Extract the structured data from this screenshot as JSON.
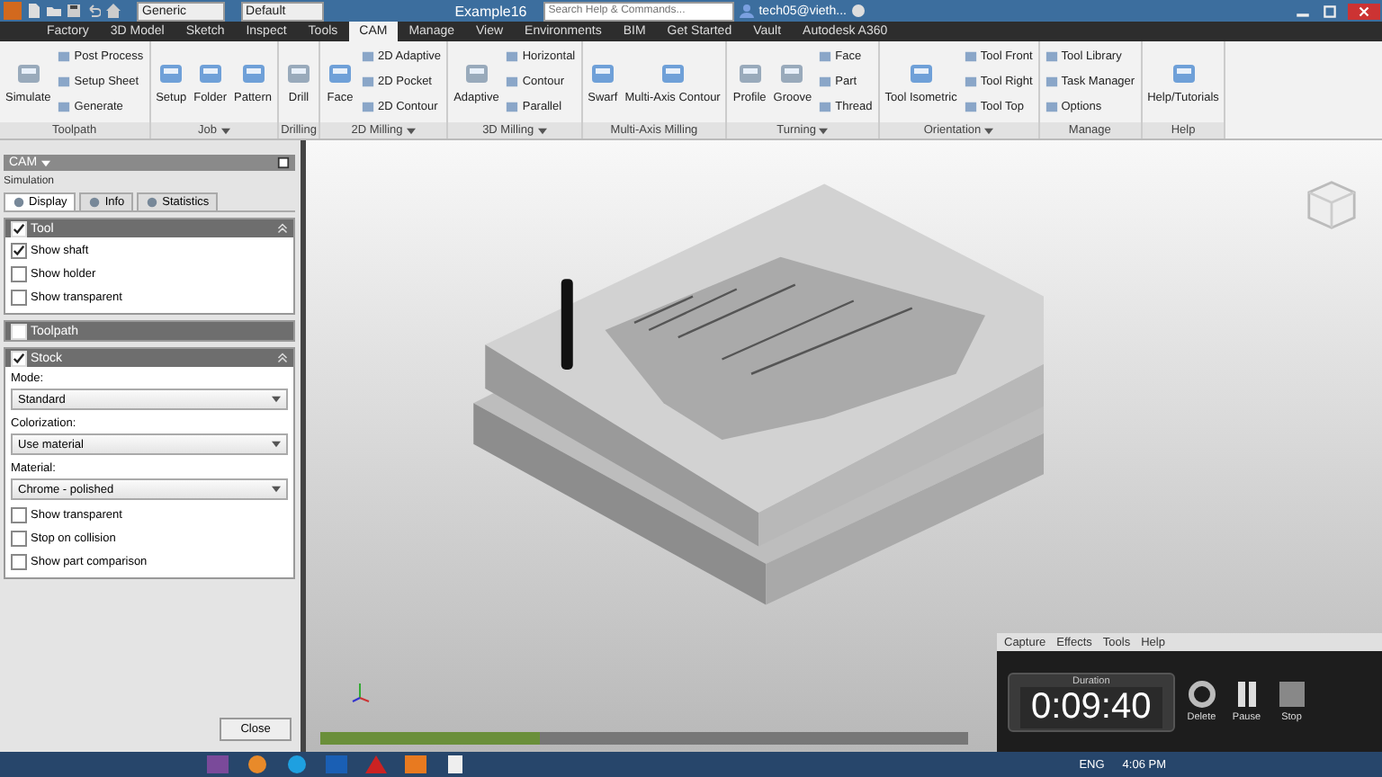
{
  "title_bar": {
    "style_dropdowns": [
      "Generic",
      "Default"
    ],
    "title": "Example16",
    "search": {
      "placeholder": "Search Help & Commands..."
    },
    "user": "tech05@vieth..."
  },
  "tabs": [
    {
      "label": "Factory",
      "selected": false
    },
    {
      "label": "3D Model",
      "selected": false
    },
    {
      "label": "Sketch",
      "selected": false
    },
    {
      "label": "Inspect",
      "selected": false
    },
    {
      "label": "Tools",
      "selected": false
    },
    {
      "label": "CAM",
      "selected": true
    },
    {
      "label": "Manage",
      "selected": false
    },
    {
      "label": "View",
      "selected": false
    },
    {
      "label": "Environments",
      "selected": false
    },
    {
      "label": "BIM",
      "selected": false
    },
    {
      "label": "Get Started",
      "selected": false
    },
    {
      "label": "Vault",
      "selected": false
    },
    {
      "label": "Autodesk A360",
      "selected": false
    }
  ],
  "ribbon": [
    {
      "label": "Toolpath",
      "menu": false,
      "large": [
        "Simulate"
      ],
      "small": [
        "Post Process",
        "Setup Sheet",
        "Generate"
      ]
    },
    {
      "label": "Job",
      "menu": true,
      "large": [
        "Setup",
        "Folder",
        "Pattern"
      ]
    },
    {
      "label": "Drilling",
      "menu": false,
      "large": [
        "Drill"
      ]
    },
    {
      "label": "2D Milling",
      "menu": true,
      "large": [
        "Face"
      ],
      "small": [
        "2D Adaptive",
        "2D Pocket",
        "2D Contour"
      ]
    },
    {
      "label": "3D Milling",
      "menu": true,
      "large": [
        "Adaptive"
      ],
      "small": [
        "Horizontal",
        "Contour",
        "Parallel"
      ]
    },
    {
      "label": "Multi-Axis Milling",
      "menu": false,
      "large": [
        "Swarf",
        "Multi-Axis Contour"
      ]
    },
    {
      "label": "Turning",
      "menu": true,
      "large": [
        "Profile",
        "Groove"
      ],
      "small": [
        "Face",
        "Part",
        "Thread"
      ]
    },
    {
      "label": "Orientation",
      "menu": true,
      "large": [
        "Tool Isometric"
      ],
      "small": [
        "Tool Front",
        "Tool Right",
        "Tool Top"
      ]
    },
    {
      "label": "Manage",
      "menu": false,
      "small": [
        "Tool Library",
        "Task Manager",
        "Options"
      ]
    },
    {
      "label": "Help",
      "menu": false,
      "large": [
        "Help/Tutorials"
      ]
    }
  ],
  "panel": {
    "title": "CAM",
    "subtitle": "Simulation",
    "tabs": [
      {
        "label": "Display",
        "selected": true
      },
      {
        "label": "Info",
        "selected": false
      },
      {
        "label": "Statistics",
        "selected": false
      }
    ],
    "sections": [
      {
        "title": "Tool",
        "checked": true,
        "expanded": true,
        "items": [
          {
            "kind": "checkbox",
            "label": "Show shaft",
            "checked": true
          },
          {
            "kind": "checkbox",
            "label": "Show holder",
            "checked": false
          },
          {
            "kind": "checkbox",
            "label": "Show transparent",
            "checked": false
          }
        ]
      },
      {
        "title": "Toolpath",
        "checked": false,
        "expanded": false
      },
      {
        "title": "Stock",
        "checked": true,
        "expanded": true,
        "items": [
          {
            "kind": "select",
            "label": "Mode:",
            "value": "Standard"
          },
          {
            "kind": "select",
            "label": "Colorization:",
            "value": "Use material"
          },
          {
            "kind": "select",
            "label": "Material:",
            "value": "Chrome - polished"
          },
          {
            "kind": "checkbox",
            "label": "Show transparent",
            "checked": false
          },
          {
            "kind": "checkbox",
            "label": "Stop on collision",
            "checked": false
          },
          {
            "kind": "checkbox",
            "label": "Show part comparison",
            "checked": false
          }
        ]
      }
    ],
    "close_button": "Close"
  },
  "simulation_progress": {
    "level": 0.34
  },
  "recorder": {
    "menu": [
      "Capture",
      "Effects",
      "Tools",
      "Help"
    ],
    "duration_label": "Duration",
    "duration": "0:09:40",
    "buttons": [
      {
        "kind": "delete",
        "label": "Delete"
      },
      {
        "kind": "pause",
        "label": "Pause"
      },
      {
        "kind": "stop",
        "label": "Stop"
      }
    ]
  },
  "taskbar": {
    "language": "ENG",
    "time": "4:06 PM"
  }
}
